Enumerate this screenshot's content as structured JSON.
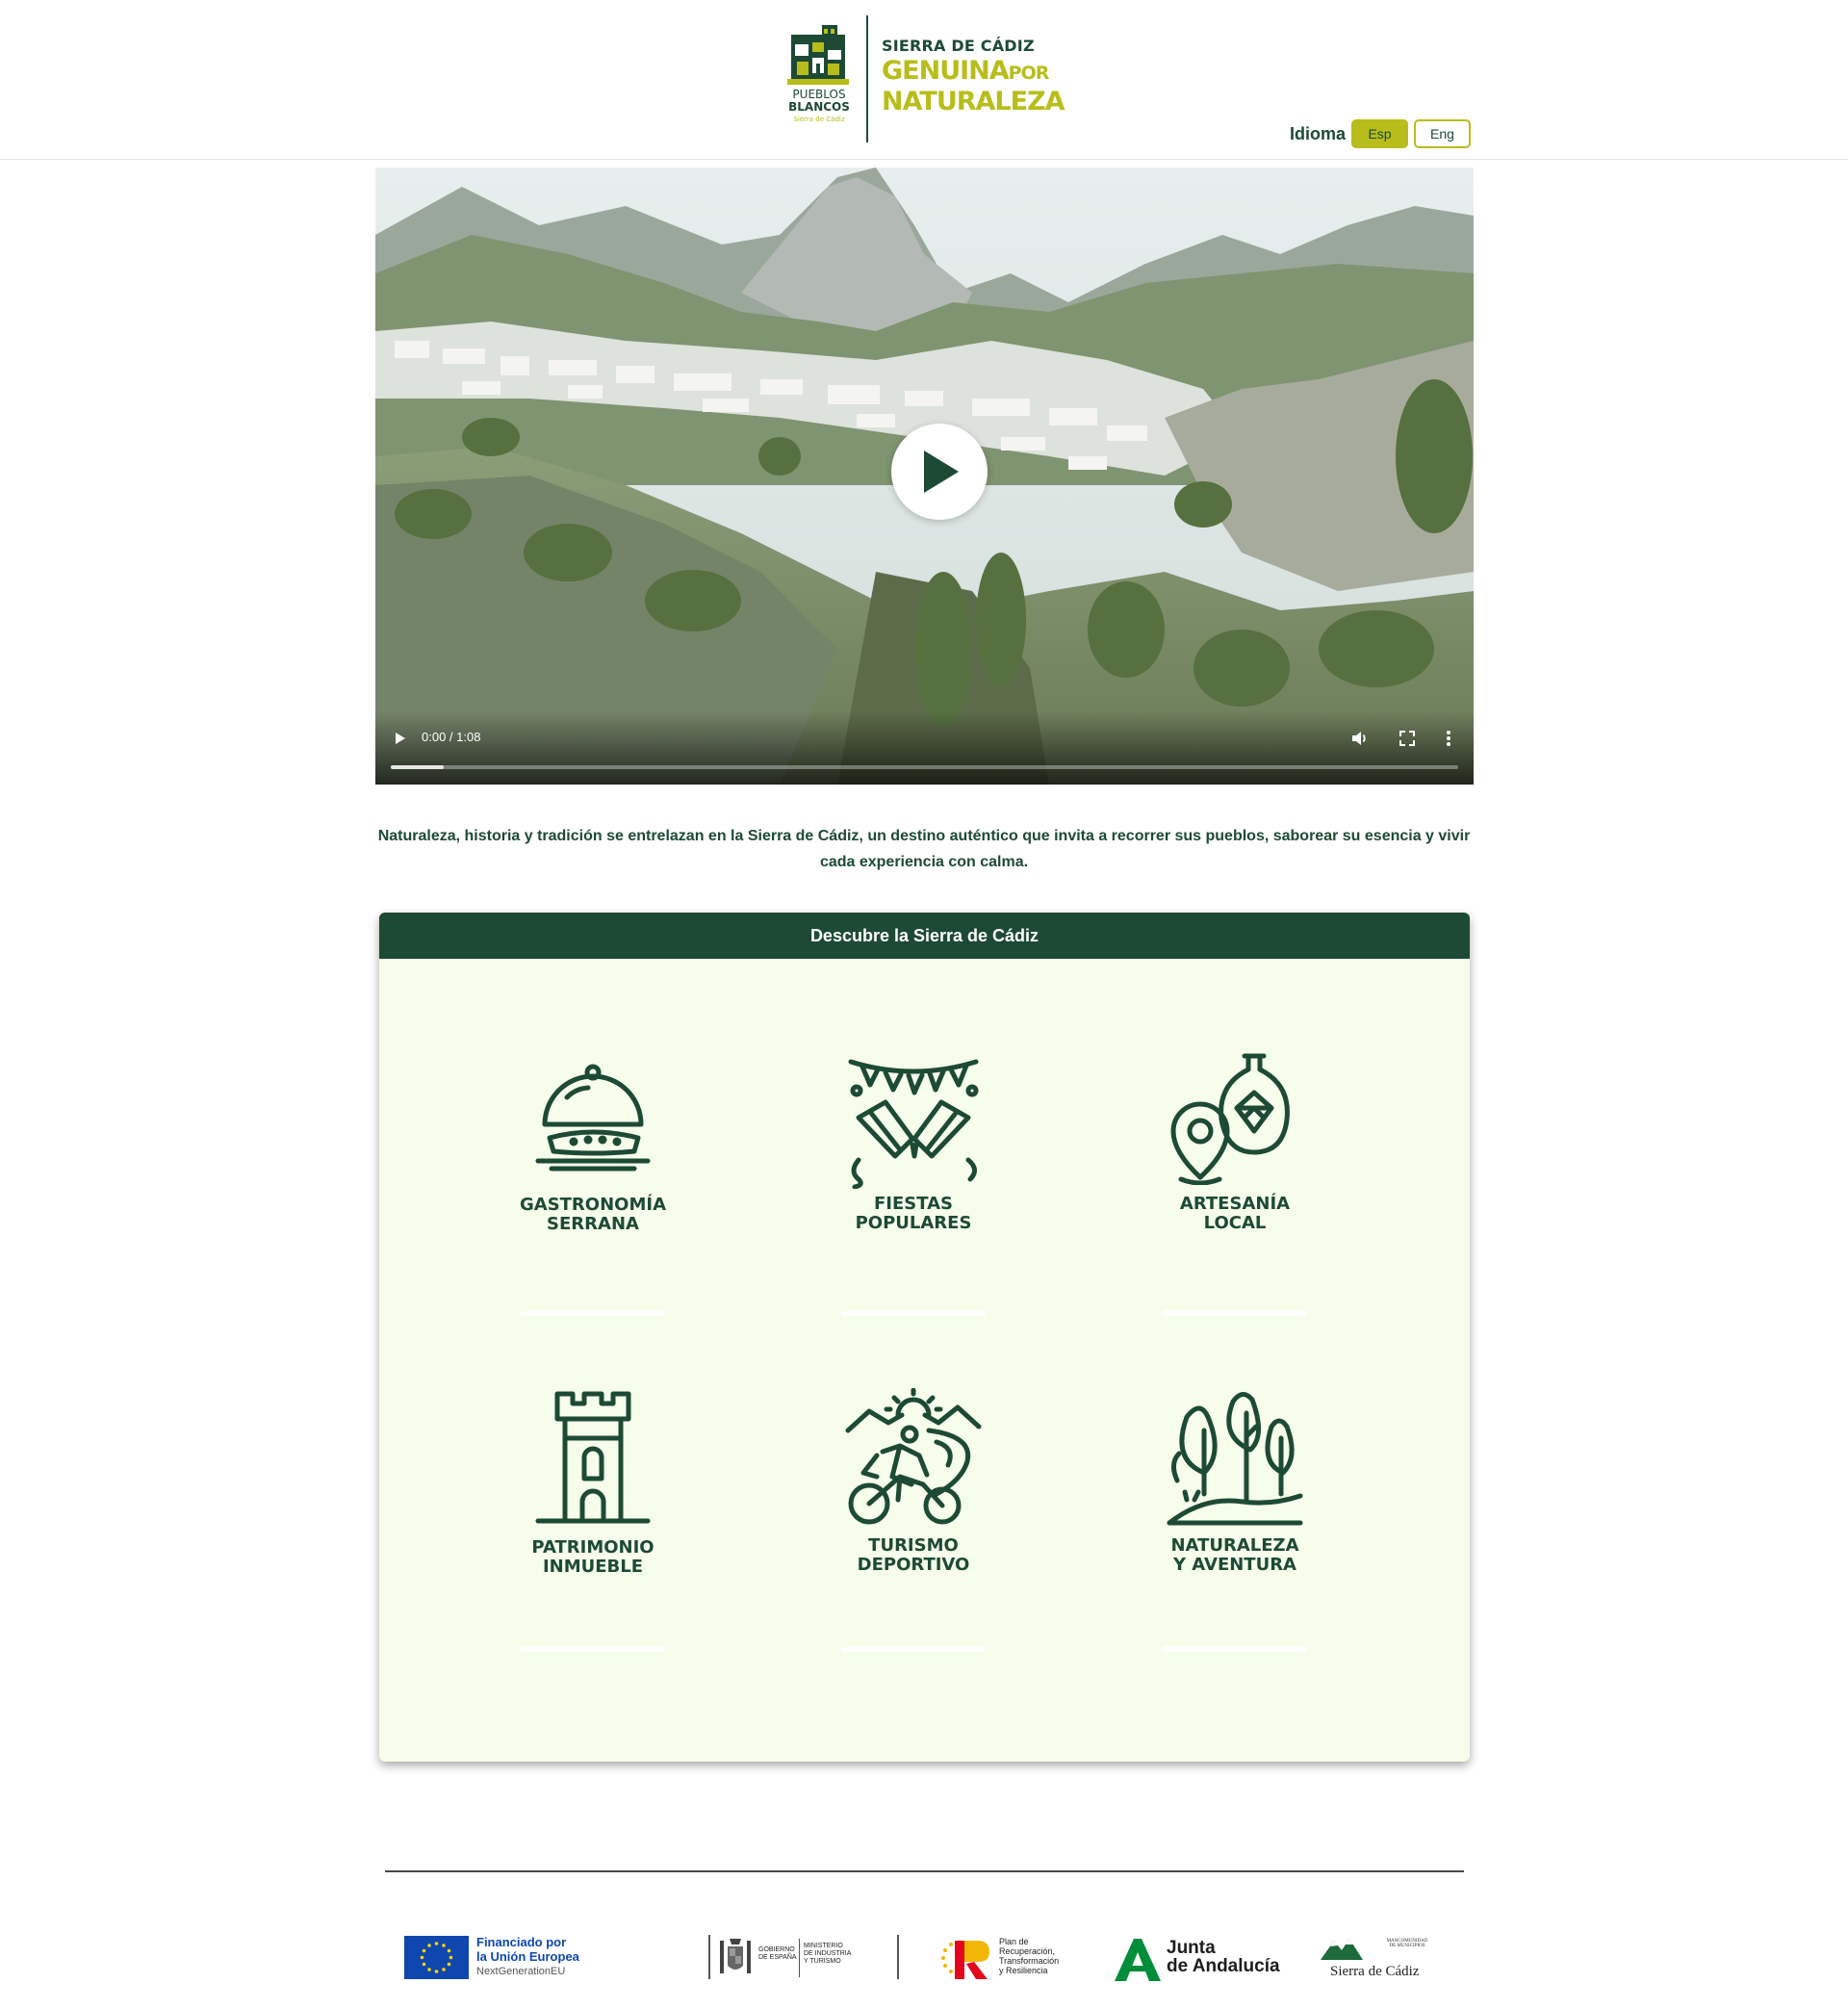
{
  "header": {
    "logo": {
      "pueblos_line1": "PUEBLOS",
      "pueblos_line2": "BLANCOS",
      "pueblos_line3": "Sierra de Cádiz",
      "brand_line1": "SIERRA DE CÁDIZ",
      "brand_genuina": "GENUINA",
      "brand_por": "POR",
      "brand_line3": "NATURALEZA"
    },
    "language": {
      "label": "Idioma",
      "options": [
        {
          "label": "Esp",
          "active": true
        },
        {
          "label": "Eng",
          "active": false
        }
      ]
    }
  },
  "video": {
    "current_time": "0:00",
    "duration": "1:08",
    "time_separator": " / ",
    "progress_fraction": 0.05
  },
  "intro": {
    "text": "Naturaleza, historia y tradición se entrelazan en la Sierra de Cádiz, un destino auténtico que invita a recorrer sus pueblos, saborear su esencia y vivir cada experiencia con calma."
  },
  "discover": {
    "title": "Descubre la Sierra de Cádiz",
    "categories": [
      {
        "line1": "GASTRONOMÍA",
        "line2": "SERRANA",
        "icon": "food-cloche-icon"
      },
      {
        "line1": "FIESTAS",
        "line2": "POPULARES",
        "icon": "festival-bunting-icon"
      },
      {
        "line1": "ARTESANÍA",
        "line2": "LOCAL",
        "icon": "pottery-pin-icon"
      },
      {
        "line1": "PATRIMONIO",
        "line2": "INMUEBLE",
        "icon": "castle-tower-icon"
      },
      {
        "line1": "TURISMO",
        "line2": "DEPORTIVO",
        "icon": "mountain-bike-icon"
      },
      {
        "line1": "NATURALEZA",
        "line2": "Y AVENTURA",
        "icon": "forest-trees-icon"
      }
    ]
  },
  "footer": {
    "sponsors": {
      "eu_line1": "Financiado por",
      "eu_line2": "la Unión Europea",
      "eu_line3": "NextGenerationEU",
      "gobierno_line1": "GOBIERNO",
      "gobierno_line2": "DE ESPAÑA",
      "ministerio_line1": "MINISTERIO",
      "ministerio_line2": "DE INDUSTRIA",
      "ministerio_line3": "Y TURISMO",
      "plan_line1": "Plan de",
      "plan_line2": "Recuperación,",
      "plan_line3": "Transformación",
      "plan_line4": "y Resiliencia",
      "junta_line1": "Junta",
      "junta_line2": "de Andalucía",
      "mancomunidad_line1": "MANCOMUNIDAD",
      "mancomunidad_line2": "DE MUNICIPIOS",
      "sierra_label": "Sierra de Cádiz"
    }
  },
  "colors": {
    "brand_green": "#1d4a34",
    "brand_lime": "#b8bd1b",
    "panel_bg": "#f6fdeb",
    "eu_blue": "#0f47af"
  }
}
